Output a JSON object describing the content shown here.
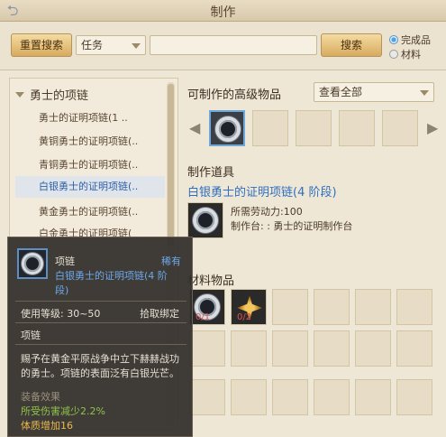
{
  "window": {
    "title": "制作"
  },
  "search": {
    "reset_label": "重置搜索",
    "category_value": "任务",
    "query_value": "",
    "search_label": "搜索",
    "radio_finished": "完成品",
    "radio_material": "材料"
  },
  "tree": {
    "group_label": "勇士的项链",
    "items": [
      "勇士的证明项链(1 ..",
      "黄铜勇士的证明项链(..",
      "青铜勇士的证明项链(..",
      "白银勇士的证明项链(..",
      "黄金勇士的证明项链(..",
      "白金勇士的证明项链("
    ],
    "selected_index": 3
  },
  "craftable": {
    "title": "可制作的高级物品",
    "filter_value": "查看全部"
  },
  "tool": {
    "title": "制作道具",
    "item_name": "白银勇士的证明项链(4 阶段)",
    "labor_line": "所需劳动力:100",
    "station_line": "制作台: : 勇士的证明制作台"
  },
  "materials": {
    "title": "材料物品",
    "slot1_count": "0/1",
    "slot2_count": "0/2"
  },
  "tooltip": {
    "type": "项链",
    "rarity": "稀有",
    "name_line1": "白银勇士的证明项链(4 阶",
    "name_line2": "段)",
    "level_line": "使用等级: 30~50",
    "bind_text": "拾取绑定",
    "category": "项链",
    "desc_line1": "赐予在黄金平原战争中立下赫赫战功",
    "desc_line2": "的勇士。项链的表面泛有白银光芒。",
    "effect_title": "装备效果",
    "effect1": "所受伤害减少2.2%",
    "effect2": "体质增加16"
  },
  "colors": {
    "accent_blue": "#2f6fc0",
    "effect_green": "#8fc24a",
    "effect_gold": "#e8b84c"
  }
}
